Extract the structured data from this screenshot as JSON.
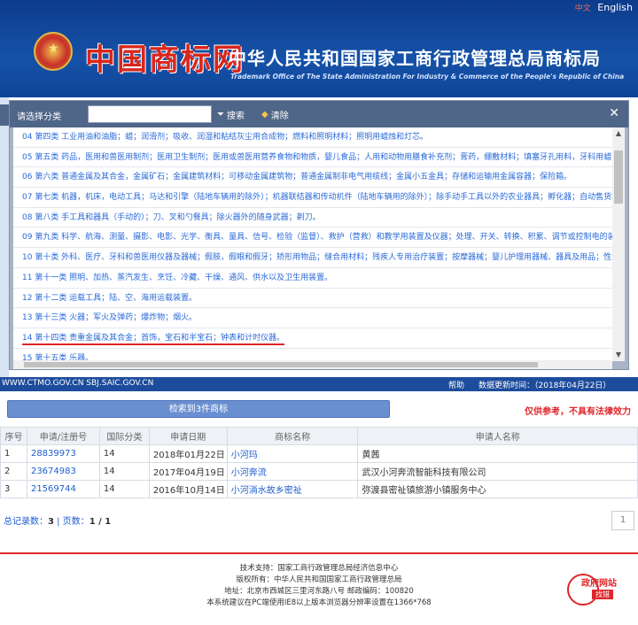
{
  "header": {
    "lang_cn": "中文",
    "lang_en": "English",
    "brand": "中国商标网",
    "org_name": "中华人民共和国国家工商行政管理总局商标局",
    "org_name_en": "Trademark Office of The State Administration For Industry & Commerce of the People's Republic of China"
  },
  "modal": {
    "select_label": "请选择分类",
    "search_placeholder": "",
    "search_btn": "搜索",
    "clear_btn": "清除",
    "close": "✕",
    "items": [
      "04 第四类 工业用油和油脂；蜡；润滑剂；吸收、润湿和粘结灰尘用合成物；燃料和照明材料；照明用蜡烛和灯芯。",
      "05 第五类 药品，医用和兽医用制剂；医用卫生制剂；医用或兽医用营养食物和物质，婴儿食品；人用和动物用膳食补充剂；膏药，绷敷材料；填塞牙孔用料，牙科用蜡；消毒剂；消灭有害动物制剂；杀真菌剂，除莠剂。",
      "06 第六类 普通金属及其合金，金属矿石；金属建筑材料；可移动金属建筑物；普通金属制非电气用缆线；金属小五金具；存储和运输用金属容器；保险箱。",
      "07 第七类 机器，机床，电动工具；马达和引擎（陆地车辆用的除外）；机器联结器和传动机件（陆地车辆用的除外）；除手动手工具以外的农业器具；孵化器；自动售货机。",
      "08 第八类 手工具和器具（手动的）；刀、叉和勺餐具；除火器外的随身武器；剃刀。",
      "09 第九类 科学、航海、测量、摄影、电影、光学、衡具、量具、信号、检验（监督）、救护（营救）和教学用装置及仪器；处理、开关、转换、积累、调节或控制电的装置和仪器。",
      "10 第十类 外科、医疗、牙科和兽医用仪器及器械；假肢，假眼和假牙；矫形用物品；缝合用材料；残疾人专用治疗装置；按摩器械；婴儿护理用器械、器具及用品；性生活用器械、器具及用品。",
      "11 第十一类 照明、加热、蒸汽发生、烹饪、冷藏、干燥、通风、供水以及卫生用装置。",
      "12 第十二类 运载工具；陆、空、海用运载装置。",
      "13 第十三类 火器；军火及弹药；爆炸物；烟火。",
      "14 第十四类 贵重金属及其合金；首饰，宝石和半宝石；钟表和计时仪器。",
      "15 第十五类 乐器。"
    ],
    "highlight_index": 10
  },
  "statusbar": {
    "url": "WWW.CTMO.GOV.CN SBJ.SAIC.GOV.CN",
    "help": "帮助",
    "update": "数据更新时间：（2018年04月22日）"
  },
  "results": {
    "button": "检索到3件商标",
    "notice": "仅供参考，不具有法律效力",
    "columns": [
      "序号",
      "申请/注册号",
      "国际分类",
      "申请日期",
      "商标名称",
      "申请人名称"
    ],
    "rows": [
      [
        "1",
        "28839973",
        "14",
        "2018年01月22日",
        "小河玛",
        "黄茜"
      ],
      [
        "2",
        "23674983",
        "14",
        "2017年04月19日",
        "小河奔流",
        "武汉小河奔流智能科技有限公司"
      ],
      [
        "3",
        "21569744",
        "14",
        "2016年10月14日",
        "小河淌水故乡密祉",
        "弥渡县密祉镇旅游小镇服务中心"
      ]
    ],
    "summary_label": "总记录数：",
    "summary_total": "3",
    "summary_pages_label": "页数：",
    "summary_pages": "1 / 1",
    "pager_page": "1"
  },
  "footer": {
    "line1": "技术支持：国家工商行政管理总局经济信息中心",
    "line2": "版权所有：中华人民共和国国家工商行政管理总局",
    "line3": "地址：北京市西城区三里河东路八号  邮政编码：100820",
    "line4": "本系统建议在PC端使用IE8以上版本浏览器分辨率设置在1366*768"
  },
  "gov_badge": {
    "text1": "政府网站",
    "text2": "找错"
  }
}
